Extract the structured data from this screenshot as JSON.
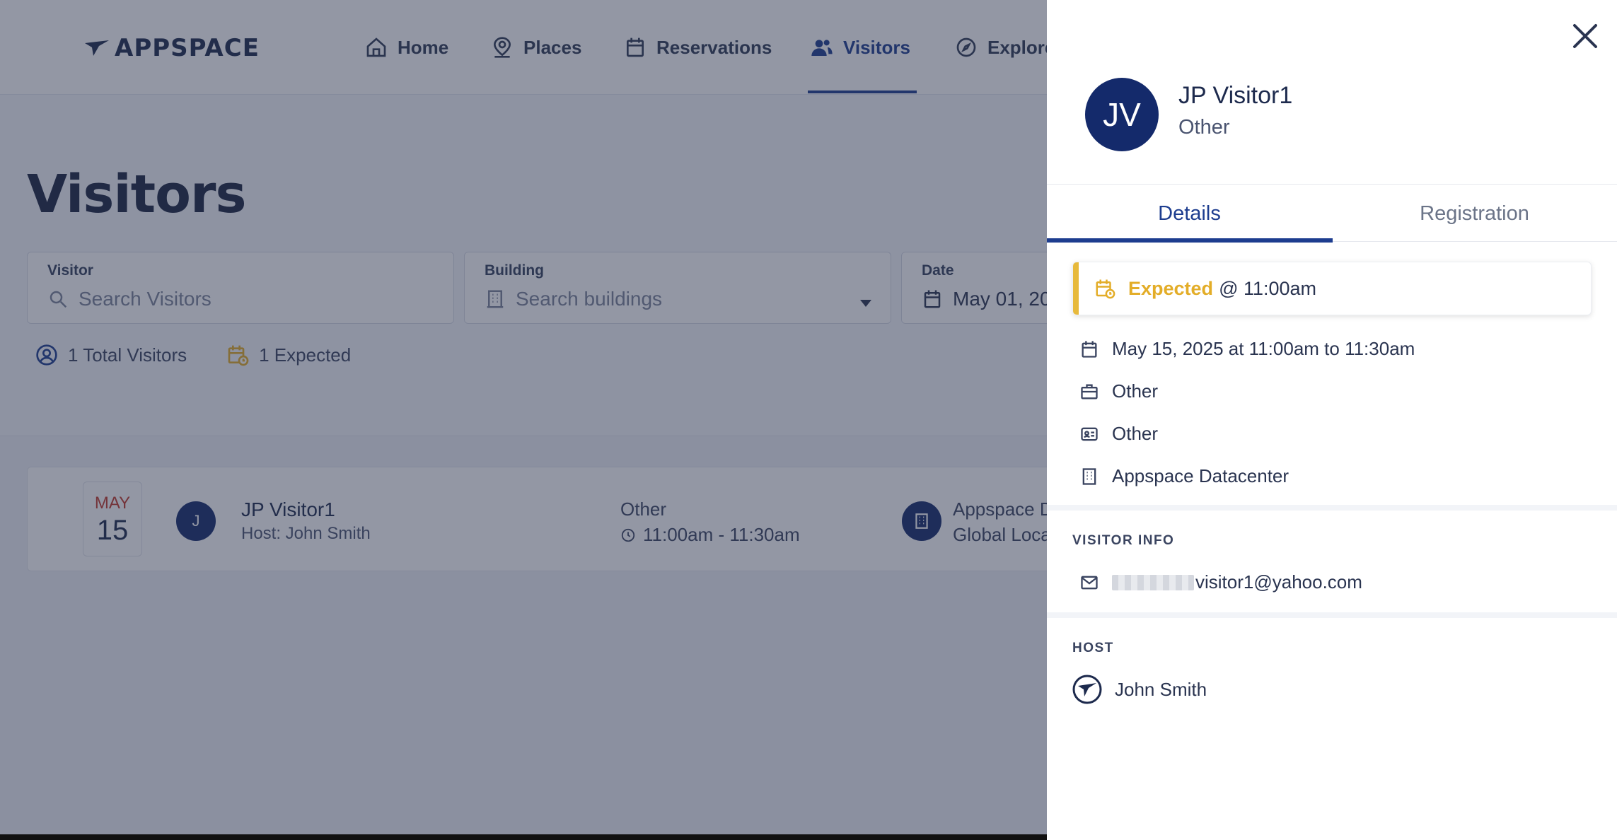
{
  "app": {
    "logo_text": "APPSPACE",
    "nav": [
      {
        "label": "Home",
        "icon": "home-icon"
      },
      {
        "label": "Places",
        "icon": "location-pin-icon"
      },
      {
        "label": "Reservations",
        "icon": "calendar-icon"
      },
      {
        "label": "Visitors",
        "icon": "users-icon",
        "active": true
      },
      {
        "label": "Explore",
        "icon": "compass-icon"
      }
    ],
    "page_title": "Visitors",
    "filters": {
      "visitor": {
        "label": "Visitor",
        "placeholder": "Search Visitors"
      },
      "building": {
        "label": "Building",
        "placeholder": "Search buildings"
      },
      "date": {
        "label": "Date",
        "value": "May 01, 20"
      }
    },
    "stats": {
      "total": "1 Total Visitors",
      "expected": "1 Expected"
    },
    "visitor_row": {
      "month": "MAY",
      "day": "15",
      "avatar_initial": "J",
      "name": "JP Visitor1",
      "host": "Host: John Smith",
      "type": "Other",
      "time": "11:00am - 11:30am",
      "building": "Appspace D",
      "location": "Global Loca"
    }
  },
  "panel": {
    "avatar_initials": "JV",
    "name": "JP Visitor1",
    "subtitle": "Other",
    "tabs": [
      {
        "label": "Details",
        "active": true
      },
      {
        "label": "Registration",
        "active": false
      }
    ],
    "status": {
      "label": "Expected",
      "time": "@ 11:00am"
    },
    "details": {
      "datetime": "May 15, 2025 at 11:00am to 11:30am",
      "visit_type": "Other",
      "id_type": "Other",
      "building": "Appspace Datacenter"
    },
    "visitor_info": {
      "heading": "VISITOR INFO",
      "email": "visitor1@yahoo.com"
    },
    "host": {
      "heading": "HOST",
      "name": "John Smith"
    }
  },
  "colors": {
    "brand_navy": "#142a6b",
    "active_blue": "#1d3d8f",
    "expected_gold": "#e3ad28"
  }
}
